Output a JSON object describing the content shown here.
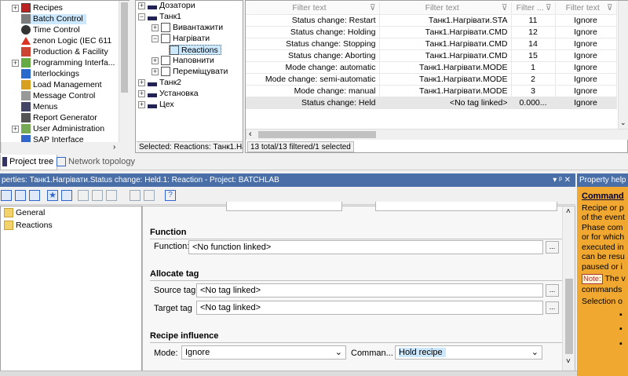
{
  "project_tree": {
    "items": [
      {
        "label": "Recipes"
      },
      {
        "label": "Batch Control"
      },
      {
        "label": "Time Control"
      },
      {
        "label": "zenon Logic (IEC 611"
      },
      {
        "label": "Production & Facility"
      },
      {
        "label": "Programming Interfa..."
      },
      {
        "label": "Interlockings"
      },
      {
        "label": "Load Management"
      },
      {
        "label": "Message Control"
      },
      {
        "label": "Menus"
      },
      {
        "label": "Report Generator"
      },
      {
        "label": "User Administration"
      },
      {
        "label": "SAP Interface"
      }
    ]
  },
  "tabs": {
    "project_tree": "Project tree",
    "network_topology": "Network topology"
  },
  "equip_tree": {
    "items": [
      {
        "label": "Дозатори"
      },
      {
        "label": "Танк1"
      },
      {
        "label": "Вивантажити"
      },
      {
        "label": "Нагрівати"
      },
      {
        "label": "Reactions"
      },
      {
        "label": "Наповнити"
      },
      {
        "label": "Переміщувати"
      },
      {
        "label": "Танк2"
      },
      {
        "label": "Установка"
      },
      {
        "label": "Цех"
      }
    ],
    "status": "Selected: Reactions: Танк1.Наг"
  },
  "grid": {
    "filter_placeholder": "Filter text",
    "filter_short": "Filter ...",
    "rows": [
      {
        "event": "Status change: Restart",
        "tag": "Танк1.Нагрівати.STA",
        "value": "11",
        "mode": "Ignore"
      },
      {
        "event": "Status change: Holding",
        "tag": "Танк1.Нагрівати.CMD",
        "value": "12",
        "mode": "Ignore"
      },
      {
        "event": "Status change: Stopping",
        "tag": "Танк1.Нагрівати.CMD",
        "value": "14",
        "mode": "Ignore"
      },
      {
        "event": "Status change: Aborting",
        "tag": "Танк1.Нагрівати.CMD",
        "value": "15",
        "mode": "Ignore"
      },
      {
        "event": "Mode change: automatic",
        "tag": "Танк1.Нагрівати.MODE",
        "value": "1",
        "mode": "Ignore"
      },
      {
        "event": "Mode change: semi-automatic",
        "tag": "Танк1.Нагрівати.MODE",
        "value": "2",
        "mode": "Ignore"
      },
      {
        "event": "Mode change: manual",
        "tag": "Танк1.Нагрівати.MODE",
        "value": "3",
        "mode": "Ignore"
      },
      {
        "event": "Status change: Held",
        "tag": "<No tag linked>",
        "value": "0.000...",
        "mode": "Ignore"
      }
    ],
    "status": "13 total/13 filtered/1 selected"
  },
  "properties": {
    "title": "perties: Танк1.Нагрівати.Status change: Held.1: Reaction - Project: BATCHLAB",
    "pin": "▾ ᵖ ✕",
    "nav": [
      {
        "label": "General"
      },
      {
        "label": "Reactions"
      }
    ],
    "function_group": "Function",
    "function_label": "Function:",
    "function_value": "<No function linked>",
    "allocate_group": "Allocate tag",
    "source_label": "Source tag",
    "source_value": "<No tag linked>",
    "target_label": "Target tag",
    "target_value": "<No tag linked>",
    "recipe_group": "Recipe influence",
    "mode_label": "Mode:",
    "mode_value": "Ignore",
    "command_label": "Comman...",
    "command_value": "Hold recipe",
    "dots": "..."
  },
  "help": {
    "title": "Property help",
    "heading": "Command",
    "lines": [
      "Recipe or p",
      "of the event",
      "Phase com",
      "or for which",
      "executed in",
      "can be resu",
      "paused or i"
    ],
    "note_label": "Note:",
    "note_text": "The v",
    "note_line2": "commands",
    "selection": "Selection o",
    "bullets": [
      "▪",
      "▪",
      "▪"
    ]
  },
  "colors": {
    "accent": "#f0a830",
    "titlebar": "#4a6fa8",
    "selection": "#cce8ff",
    "help_bg": "#ffffe1"
  }
}
